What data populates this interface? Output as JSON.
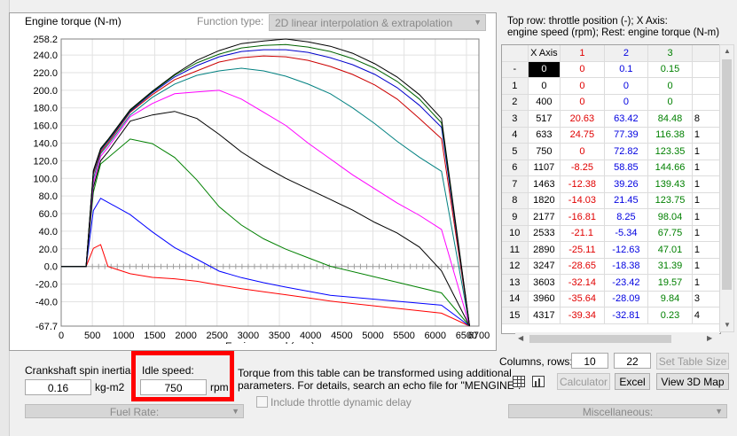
{
  "window": {
    "plot_title": "Engine torque (N-m)",
    "function_type_label": "Function type:",
    "function_type_value": "2D linear interpolation & extrapolation",
    "table_caption_line1": "Top row: throttle position (-); X Axis:",
    "table_caption_line2": "engine speed (rpm); Rest: engine torque (N-m)"
  },
  "chart_data": {
    "type": "line",
    "xlabel": "Engine speed (rpm)",
    "ylabel": "Engine torque (N-m)",
    "xlim": [
      0,
      6700
    ],
    "ylim": [
      -67.7,
      258.2
    ],
    "x_ticks": [
      "0",
      "500",
      "1000",
      "1500",
      "2000",
      "2500",
      "3000",
      "3500",
      "4000",
      "4500",
      "5000",
      "5500",
      "6000",
      "6500",
      "6700"
    ],
    "y_ticks": [
      "258.2",
      "240.0",
      "220.0",
      "200.0",
      "180.0",
      "160.0",
      "140.0",
      "120.0",
      "100.0",
      "80.0",
      "60.0",
      "40.0",
      "20.0",
      "0.0",
      "-20.0",
      "-40.0",
      "-67.7"
    ],
    "grid": true,
    "series": [
      {
        "color": "#ff0000",
        "x": [
          0,
          400,
          517,
          633,
          750,
          1107,
          1463,
          1820,
          2177,
          2533,
          2890,
          3247,
          3603,
          3960,
          4317,
          6100,
          6550
        ],
        "y": [
          0,
          0,
          20.63,
          24.75,
          0,
          -8.25,
          -12.38,
          -14.03,
          -16.81,
          -21.1,
          -25.11,
          -28.65,
          -32.14,
          -35.64,
          -39.34,
          -53,
          -67.7
        ]
      },
      {
        "color": "#0000ff",
        "x": [
          0,
          400,
          517,
          633,
          750,
          1107,
          1463,
          1820,
          2177,
          2533,
          2890,
          3247,
          3603,
          3960,
          4317,
          6100,
          6550
        ],
        "y": [
          0,
          0,
          63.42,
          77.39,
          72.82,
          58.85,
          39.26,
          21.45,
          8.25,
          -5.34,
          -12.63,
          -18.38,
          -23.42,
          -28.09,
          -32.81,
          -44,
          -67.7
        ]
      },
      {
        "color": "#008000",
        "x": [
          0,
          400,
          517,
          633,
          750,
          1107,
          1463,
          1820,
          2177,
          2533,
          2890,
          3247,
          3603,
          3960,
          4317,
          6100,
          6550
        ],
        "y": [
          0,
          0,
          84.48,
          116.38,
          123.35,
          144.66,
          139.43,
          123.75,
          98.04,
          67.75,
          47.01,
          31.39,
          19.57,
          9.84,
          0.23,
          -30,
          -67.7
        ]
      },
      {
        "color": "#000000",
        "x": [
          0,
          400,
          517,
          633,
          750,
          1107,
          1463,
          1820,
          2177,
          2533,
          2890,
          3247,
          3603,
          3960,
          4317,
          4674,
          5031,
          5388,
          5745,
          6100,
          6550
        ],
        "y": [
          0,
          0,
          90,
          120,
          130,
          165,
          172,
          176,
          168,
          150,
          130,
          114,
          100,
          88,
          76,
          64,
          50,
          38,
          22,
          -5,
          -67.7
        ]
      },
      {
        "color": "#ff00ff",
        "x": [
          0,
          400,
          517,
          633,
          750,
          1107,
          1463,
          1820,
          2177,
          2533,
          2890,
          3247,
          3603,
          3960,
          4317,
          4674,
          5031,
          5388,
          5745,
          6100,
          6550
        ],
        "y": [
          0,
          0,
          95,
          125,
          135,
          170,
          185,
          196,
          198,
          200,
          190,
          175,
          160,
          140,
          122,
          104,
          88,
          72,
          58,
          42,
          -67.7
        ]
      },
      {
        "color": "#008080",
        "x": [
          0,
          400,
          517,
          633,
          750,
          1107,
          1463,
          1820,
          2177,
          2533,
          2890,
          3247,
          3603,
          3960,
          4317,
          4674,
          5031,
          5388,
          5745,
          6100,
          6550
        ],
        "y": [
          0,
          0,
          100,
          128,
          138,
          172,
          192,
          207,
          217,
          222,
          225,
          222,
          216,
          207,
          196,
          180,
          162,
          142,
          124,
          108,
          -67.7
        ]
      },
      {
        "color": "#cc0000",
        "x": [
          0,
          400,
          517,
          633,
          750,
          1107,
          1463,
          1820,
          2177,
          2533,
          2890,
          3247,
          3603,
          3960,
          4317,
          4674,
          5031,
          5388,
          5745,
          6100,
          6550
        ],
        "y": [
          0,
          0,
          105,
          130,
          140,
          175,
          195,
          212,
          222,
          232,
          237,
          239,
          238,
          234,
          227,
          218,
          206,
          190,
          168,
          145,
          -67.7
        ]
      },
      {
        "color": "#0000cc",
        "x": [
          0,
          400,
          517,
          633,
          750,
          1107,
          1463,
          1820,
          2177,
          2533,
          2890,
          3247,
          3603,
          3960,
          4317,
          4674,
          5031,
          5388,
          5745,
          6100,
          6550
        ],
        "y": [
          0,
          0,
          107,
          132,
          142,
          176,
          197,
          215,
          228,
          238,
          244,
          246,
          246,
          243,
          237,
          229,
          218,
          203,
          183,
          158,
          -67.7
        ]
      },
      {
        "color": "#006400",
        "x": [
          0,
          400,
          517,
          633,
          750,
          1107,
          1463,
          1820,
          2177,
          2533,
          2890,
          3247,
          3603,
          3960,
          4317,
          4674,
          5031,
          5388,
          5745,
          6100,
          6550
        ],
        "y": [
          0,
          0,
          108,
          133,
          143,
          177,
          198,
          217,
          231,
          241,
          248,
          251,
          252,
          249,
          244,
          236,
          225,
          210,
          190,
          163,
          -67.7
        ]
      },
      {
        "color": "#000000",
        "x": [
          0,
          400,
          517,
          633,
          750,
          1107,
          1463,
          1820,
          2177,
          2533,
          2890,
          3247,
          3603,
          3960,
          4317,
          4674,
          5031,
          5388,
          5745,
          6100,
          6550
        ],
        "y": [
          0,
          0,
          109,
          134,
          144,
          178,
          199,
          218,
          234,
          245,
          253,
          256,
          258.2,
          255,
          250,
          242,
          230,
          215,
          195,
          168,
          -67.7
        ]
      }
    ]
  },
  "table": {
    "headers": [
      "X Axis",
      "1",
      "2",
      "3",
      ""
    ],
    "throttle_row": {
      "label": "-",
      "cells": [
        "0",
        "0",
        "0.1",
        "0.15",
        ""
      ]
    },
    "rows": [
      {
        "label": "1",
        "cells": [
          "0",
          "0",
          "0",
          "0",
          ""
        ]
      },
      {
        "label": "2",
        "cells": [
          "400",
          "0",
          "0",
          "0",
          ""
        ]
      },
      {
        "label": "3",
        "cells": [
          "517",
          "20.63",
          "63.42",
          "84.48",
          "8"
        ]
      },
      {
        "label": "4",
        "cells": [
          "633",
          "24.75",
          "77.39",
          "116.38",
          "1"
        ]
      },
      {
        "label": "5",
        "cells": [
          "750",
          "0",
          "72.82",
          "123.35",
          "1"
        ]
      },
      {
        "label": "6",
        "cells": [
          "1107",
          "-8.25",
          "58.85",
          "144.66",
          "1"
        ]
      },
      {
        "label": "7",
        "cells": [
          "1463",
          "-12.38",
          "39.26",
          "139.43",
          "1"
        ]
      },
      {
        "label": "8",
        "cells": [
          "1820",
          "-14.03",
          "21.45",
          "123.75",
          "1"
        ]
      },
      {
        "label": "9",
        "cells": [
          "2177",
          "-16.81",
          "8.25",
          "98.04",
          "1"
        ]
      },
      {
        "label": "10",
        "cells": [
          "2533",
          "-21.1",
          "-5.34",
          "67.75",
          "1"
        ]
      },
      {
        "label": "11",
        "cells": [
          "2890",
          "-25.11",
          "-12.63",
          "47.01",
          "1"
        ]
      },
      {
        "label": "12",
        "cells": [
          "3247",
          "-28.65",
          "-18.38",
          "31.39",
          "1"
        ]
      },
      {
        "label": "13",
        "cells": [
          "3603",
          "-32.14",
          "-23.42",
          "19.57",
          "1"
        ]
      },
      {
        "label": "14",
        "cells": [
          "3960",
          "-35.64",
          "-28.09",
          "9.84",
          "3"
        ]
      },
      {
        "label": "15",
        "cells": [
          "4317",
          "-39.34",
          "-32.81",
          "0.23",
          "4"
        ]
      }
    ]
  },
  "bottom": {
    "inertia_label": "Crankshaft spin inertia:",
    "inertia_value": "0.16",
    "inertia_unit": "kg-m2",
    "idle_label": "Idle speed:",
    "idle_value": "750",
    "idle_unit": "rpm",
    "note_line1": "Torque from this table can be transformed using additional",
    "note_line2": "parameters. For details, search an echo file for \"MENGINE\".",
    "columns_rows_label": "Columns, rows:",
    "columns_value": "10",
    "rows_value": "22",
    "set_table_size": "Set Table Size",
    "calculator": "Calculator",
    "excel": "Excel",
    "view3d": "View 3D Map",
    "fuel_rate": "Fuel Rate:",
    "throttle_dynamic": "Include throttle dynamic delay",
    "misc": "Miscellaneous:"
  }
}
